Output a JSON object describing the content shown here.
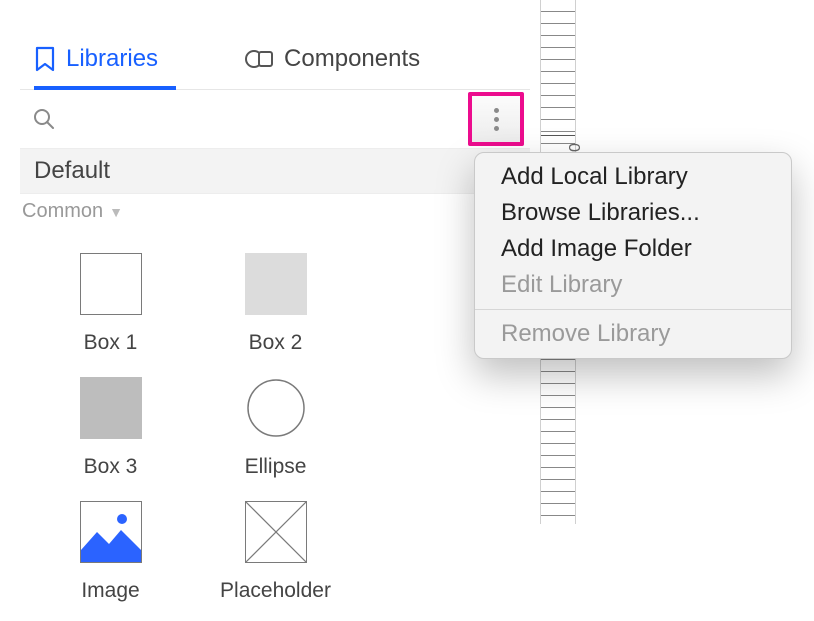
{
  "tabs": {
    "libraries": "Libraries",
    "components": "Components"
  },
  "search": {
    "placeholder": ""
  },
  "library": {
    "name": "Default"
  },
  "section": {
    "label": "Common"
  },
  "items": [
    {
      "label": "Box 1"
    },
    {
      "label": "Box 2"
    },
    {
      "label": "Box 3"
    },
    {
      "label": "Ellipse"
    },
    {
      "label": "Image"
    },
    {
      "label": "Placeholder"
    }
  ],
  "menu": {
    "addLocal": "Add Local Library",
    "browse": "Browse Libraries...",
    "addImageFolder": "Add Image Folder",
    "edit": "Edit Library",
    "remove": "Remove Library"
  },
  "ruler": {
    "label0": "0"
  }
}
